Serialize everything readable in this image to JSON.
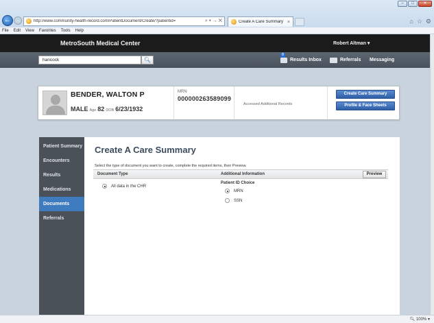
{
  "browser": {
    "url": "http://www.community-health-record.com/PatientDocument/Create/?patientid=",
    "tab_title": "Create A Care Summary",
    "window_buttons": [
      "–",
      "□",
      "✕"
    ],
    "menu": [
      "File",
      "Edit",
      "View",
      "Favorites",
      "Tools",
      "Help"
    ],
    "zoom": "100%"
  },
  "header": {
    "brand": "MetroSouth Medical Center",
    "user": "Robert Altman ▾"
  },
  "search": {
    "value": "hancock"
  },
  "topnav": {
    "results_inbox": "Results Inbox",
    "inbox_count": "0",
    "referrals": "Referrals",
    "messaging": "Messaging"
  },
  "patient": {
    "name": "BENDER, WALTON P",
    "sex": "MALE",
    "age_label": "Age",
    "age": "82",
    "dob_label": "DOB",
    "dob": "6/23/1932",
    "mrn_label": "MRN",
    "mrn": "000000263589099",
    "accessed": "Accessed Additional Records",
    "btn_care_summary": "Create Care Summary",
    "btn_profile": "Profile & Face Sheets"
  },
  "sidebar": {
    "items": [
      {
        "label": "Patient Summary",
        "active": false
      },
      {
        "label": "Encounters",
        "active": false
      },
      {
        "label": "Results",
        "active": false
      },
      {
        "label": "Medications",
        "active": false
      },
      {
        "label": "Documents",
        "active": true
      },
      {
        "label": "Referrals",
        "active": false
      }
    ]
  },
  "main": {
    "title": "Create A Care Summary",
    "instructions": "Select the type of document you want to create, complete the required items, then Preview.",
    "col_document_type": "Document Type",
    "col_additional_info": "Additional Information",
    "preview_label": "Preview",
    "document_option": "All data in the CHR",
    "patient_id_choice_label": "Patient ID Choice",
    "id_options": [
      "MRN",
      "SSN"
    ]
  }
}
